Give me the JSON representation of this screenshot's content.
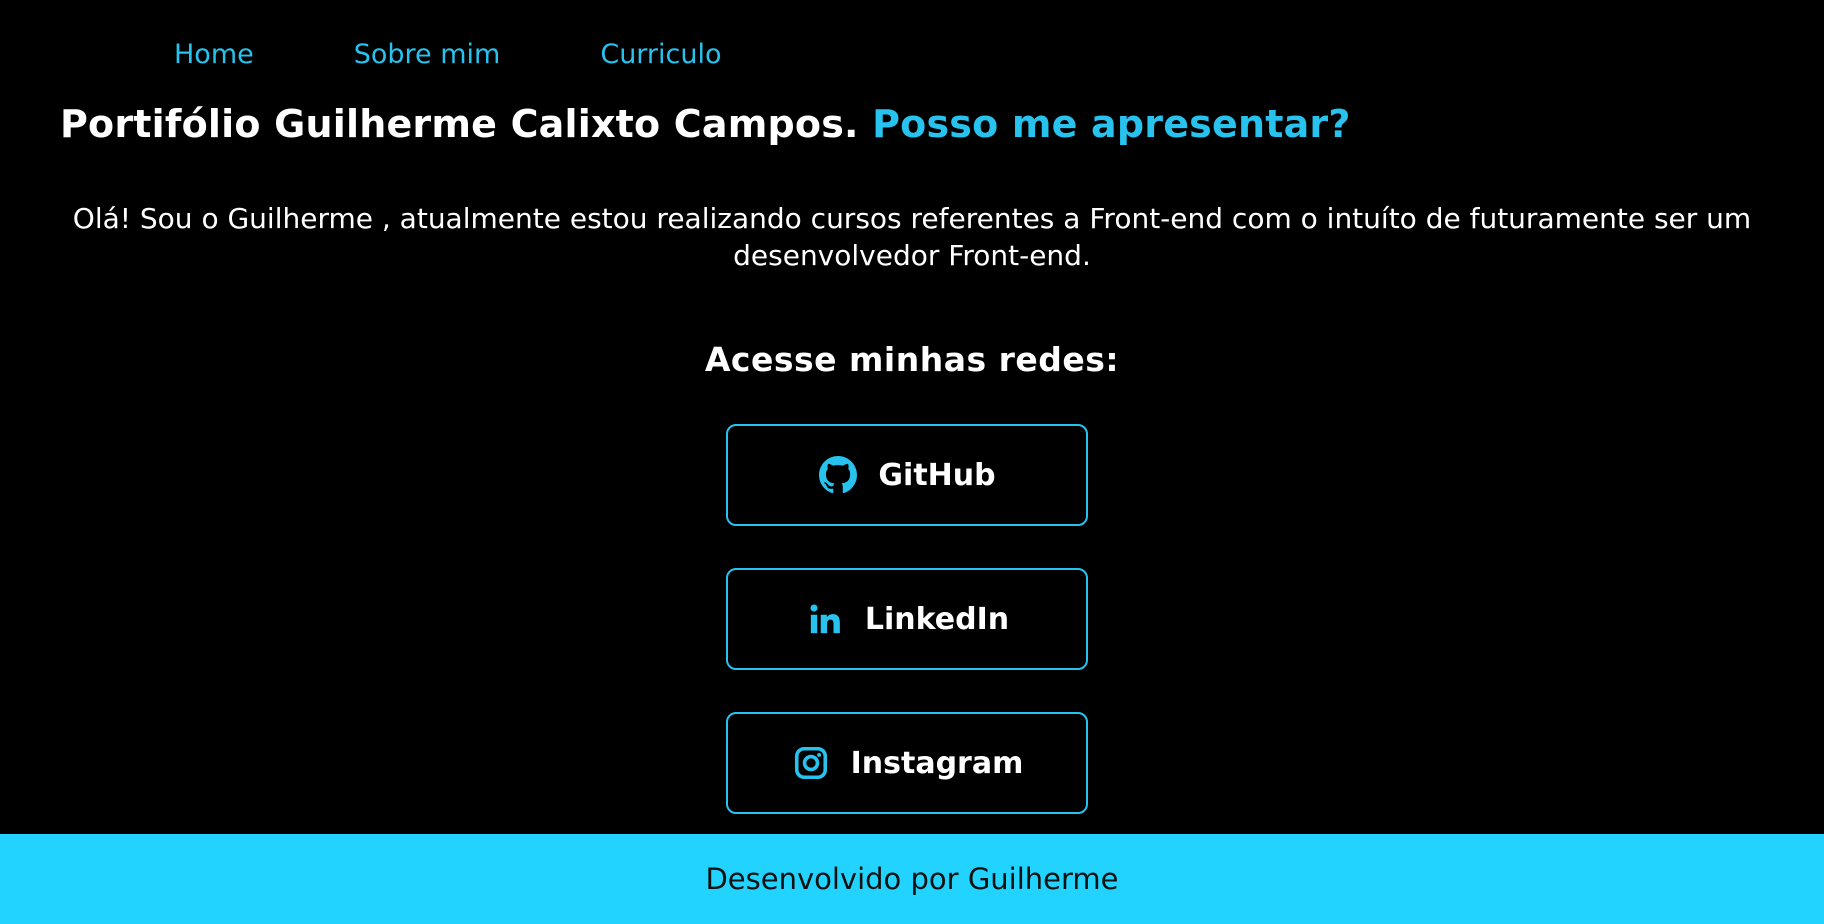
{
  "nav": {
    "items": [
      {
        "label": "Home"
      },
      {
        "label": "Sobre mim"
      },
      {
        "label": "Curriculo"
      }
    ]
  },
  "hero": {
    "title_main": "Portifólio Guilherme Calixto Campos.",
    "title_accent": "Posso me apresentar?",
    "intro_line1": "Olá! Sou o Guilherme , atualmente estou realizando cursos referentes a Front-end com o intuíto de futuramente ser um",
    "intro_line2": "desenvolvedor Front-end."
  },
  "networks": {
    "heading": "Acesse minhas redes:",
    "buttons": [
      {
        "label": "GitHub",
        "icon": "github-icon"
      },
      {
        "label": "LinkedIn",
        "icon": "linkedin-icon"
      },
      {
        "label": "Instagram",
        "icon": "instagram-icon"
      }
    ]
  },
  "footer": {
    "text": "Desenvolvido por Guilherme"
  },
  "colors": {
    "background": "#000000",
    "accent": "#27c2ee",
    "footer_bg": "#22d3ff",
    "text": "#ffffff"
  }
}
